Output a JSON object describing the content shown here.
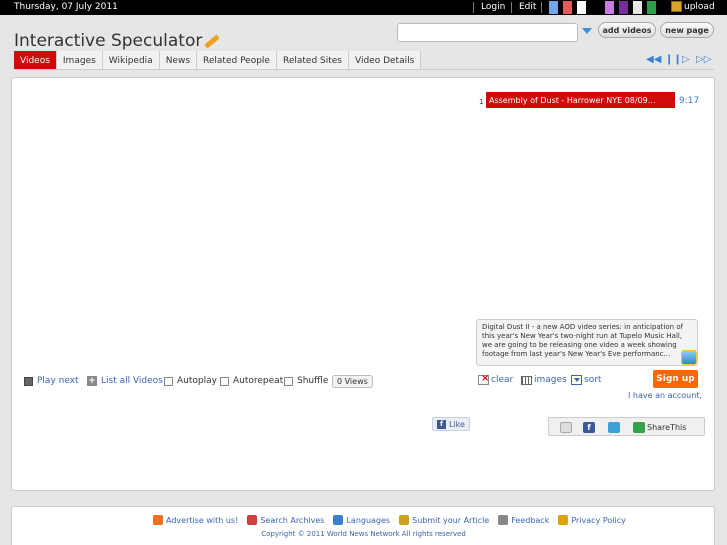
{
  "topbar": {
    "date": "Thursday, 07 July 2011",
    "login": "Login",
    "edit": "Edit",
    "upload": "upload",
    "swatches": [
      "#6fa7e8",
      "#e85a5a",
      "#ffffff",
      "#000000",
      "#c87be0",
      "#7a2c9a",
      "#e6e6e6",
      "#2aa04a"
    ]
  },
  "header": {
    "title": "Interactive Speculator",
    "search_value": "",
    "add_videos": "add videos",
    "new_page": "new page"
  },
  "tabs": [
    "Videos",
    "Images",
    "Wikipedia",
    "News",
    "Related People",
    "Related Sites",
    "Video Details"
  ],
  "playlist": {
    "items": [
      {
        "num": "1",
        "title": "Assembly of Dust - Harrower NYE 08/09...",
        "duration": "9:17"
      }
    ]
  },
  "description": "Digital Dust II - a new AOD video series: in anticipation of this year's New Year's two-night run at Tupelo Music Hall, we are going to be releasing one video a week showing footage from last year's New Year's Eve performanc...",
  "controls": {
    "play_next": "Play next",
    "list_all": "List all Videos",
    "autoplay": "Autoplay",
    "autorepeat": "Autorepeat",
    "shuffle": "Shuffle",
    "views": "0 Views"
  },
  "tools": {
    "clear": "clear",
    "images": "images",
    "sort": "sort"
  },
  "account": {
    "signup": "Sign up",
    "have_account": "I have an account, logi"
  },
  "social": {
    "like": "Like",
    "sharethis": "ShareThis"
  },
  "footer": {
    "links": [
      "Advertise with us!",
      "Search Archives",
      "Languages",
      "Submit your Article",
      "Feedback",
      "Privacy Policy"
    ],
    "link_colors": [
      "#f07020",
      "#d04040",
      "#3a7fd0",
      "#d0a020",
      "#888888",
      "#e0a000"
    ],
    "copyright": "Copyright © 2011 World News Network All rights reserved"
  }
}
